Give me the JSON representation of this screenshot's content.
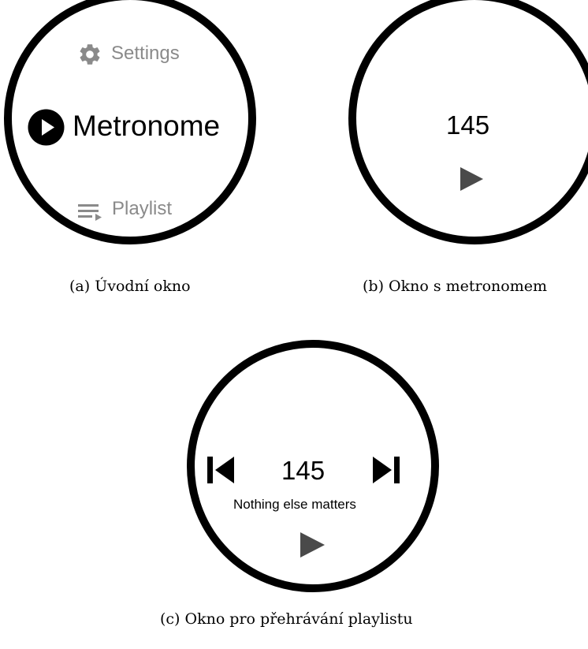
{
  "screen_a": {
    "settings_label": "Settings",
    "settings_icon": "gear-icon",
    "metronome_label": "Metronome",
    "metronome_icon": "play-circle-icon",
    "playlist_label": "Playlist",
    "playlist_icon": "playlist-icon",
    "caption": "(a) Úvodní okno"
  },
  "screen_b": {
    "bpm": "145",
    "play_icon": "play-icon",
    "caption": "(b) Okno s metronomem"
  },
  "screen_c": {
    "bpm": "145",
    "song": "Nothing else matters",
    "prev_icon": "skip-previous-icon",
    "next_icon": "skip-next-icon",
    "play_icon": "play-icon",
    "caption": "(c) Okno pro přehrávání playlistu"
  },
  "colors": {
    "ring": "#000000",
    "muted": "#8a8a8a",
    "icon": "#4a4a4a"
  }
}
